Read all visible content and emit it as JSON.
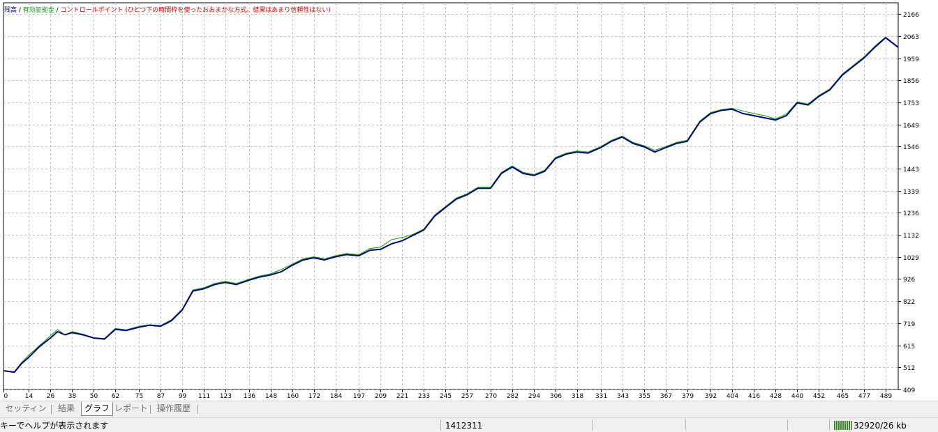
{
  "legend": {
    "balance_label": "残高",
    "equity_label": "有効証拠金",
    "note_label": "コントロールポイント (ひとつ下の時間枠を使ったおおまかな方式。結果はあまり信頼性はない)",
    "sep": " / "
  },
  "colors": {
    "balance": "#00008b",
    "equity": "#00aa00",
    "note": "#cc0000",
    "grid": "#c0c0c0",
    "axis": "#000000"
  },
  "tabs": [
    {
      "label": "セッティング",
      "active": false
    },
    {
      "label": "結果",
      "active": false
    },
    {
      "label": "グラフ",
      "active": true
    },
    {
      "label": "レポート",
      "active": false
    },
    {
      "label": "操作履歴",
      "active": false
    }
  ],
  "status": {
    "help_text": "キーでヘルプが表示されます",
    "number": "1412311",
    "memory": "32920/26 kb"
  },
  "chart_data": {
    "type": "line",
    "xlabel": "",
    "ylabel": "",
    "x_ticks": [
      0,
      14,
      26,
      38,
      50,
      62,
      75,
      87,
      99,
      111,
      123,
      136,
      148,
      160,
      172,
      184,
      197,
      209,
      221,
      233,
      245,
      257,
      270,
      282,
      294,
      306,
      318,
      331,
      343,
      355,
      367,
      379,
      392,
      404,
      416,
      428,
      440,
      452,
      465,
      477,
      489
    ],
    "y_ticks": [
      409,
      512,
      615,
      719,
      822,
      926,
      1029,
      1132,
      1236,
      1339,
      1443,
      1546,
      1649,
      1753,
      1856,
      1959,
      2063,
      2166
    ],
    "xlim": [
      0,
      496
    ],
    "ylim": [
      409,
      2166
    ],
    "grid": true,
    "legend": "top-left",
    "series": [
      {
        "name": "残高",
        "x": [
          0,
          6,
          10,
          14,
          20,
          26,
          30,
          34,
          38,
          44,
          50,
          56,
          62,
          68,
          75,
          81,
          87,
          93,
          99,
          105,
          111,
          117,
          123,
          129,
          136,
          142,
          148,
          154,
          160,
          166,
          172,
          178,
          184,
          190,
          197,
          203,
          209,
          215,
          221,
          227,
          233,
          239,
          245,
          251,
          257,
          263,
          270,
          276,
          282,
          288,
          294,
          300,
          306,
          312,
          318,
          324,
          331,
          337,
          343,
          349,
          355,
          361,
          367,
          373,
          379,
          386,
          392,
          398,
          404,
          410,
          416,
          422,
          428,
          434,
          440,
          446,
          452,
          458,
          465,
          471,
          477,
          483,
          489,
          496
        ],
        "y": [
          497,
          490,
          530,
          560,
          610,
          650,
          680,
          665,
          675,
          665,
          650,
          645,
          690,
          685,
          700,
          710,
          705,
          730,
          780,
          870,
          880,
          900,
          910,
          900,
          920,
          935,
          945,
          960,
          990,
          1015,
          1025,
          1015,
          1030,
          1040,
          1035,
          1060,
          1065,
          1090,
          1105,
          1130,
          1155,
          1220,
          1260,
          1300,
          1320,
          1350,
          1350,
          1420,
          1450,
          1420,
          1410,
          1430,
          1490,
          1510,
          1520,
          1515,
          1540,
          1570,
          1590,
          1560,
          1545,
          1520,
          1540,
          1560,
          1570,
          1660,
          1700,
          1715,
          1720,
          1700,
          1690,
          1680,
          1670,
          1690,
          1750,
          1740,
          1780,
          1810,
          1880,
          1920,
          1960,
          2010,
          2055,
          2010
        ]
      },
      {
        "name": "有効証拠金",
        "x": [
          0,
          6,
          10,
          14,
          20,
          26,
          30,
          34,
          38,
          44,
          50,
          56,
          62,
          68,
          75,
          81,
          87,
          93,
          99,
          105,
          111,
          117,
          123,
          129,
          136,
          142,
          148,
          154,
          160,
          166,
          172,
          178,
          184,
          190,
          197,
          203,
          209,
          215,
          221,
          227,
          233,
          239,
          245,
          251,
          257,
          263,
          270,
          276,
          282,
          288,
          294,
          300,
          306,
          312,
          318,
          324,
          331,
          337,
          343,
          349,
          355,
          361,
          367,
          373,
          379,
          386,
          392,
          398,
          404,
          410,
          416,
          422,
          428,
          434,
          440,
          446,
          452,
          458,
          465,
          471,
          477,
          483,
          489,
          496
        ],
        "y": [
          497,
          492,
          535,
          570,
          615,
          660,
          690,
          665,
          680,
          668,
          652,
          648,
          695,
          688,
          705,
          712,
          708,
          735,
          785,
          875,
          885,
          905,
          915,
          905,
          925,
          940,
          950,
          970,
          995,
          1020,
          1030,
          1020,
          1035,
          1045,
          1040,
          1068,
          1075,
          1110,
          1120,
          1135,
          1160,
          1225,
          1265,
          1305,
          1325,
          1355,
          1355,
          1425,
          1455,
          1425,
          1415,
          1435,
          1495,
          1515,
          1525,
          1520,
          1545,
          1575,
          1595,
          1565,
          1550,
          1528,
          1545,
          1565,
          1575,
          1665,
          1705,
          1718,
          1725,
          1712,
          1700,
          1690,
          1675,
          1698,
          1755,
          1745,
          1785,
          1815,
          1885,
          1925,
          1965,
          2015,
          2058,
          2012
        ]
      }
    ]
  }
}
